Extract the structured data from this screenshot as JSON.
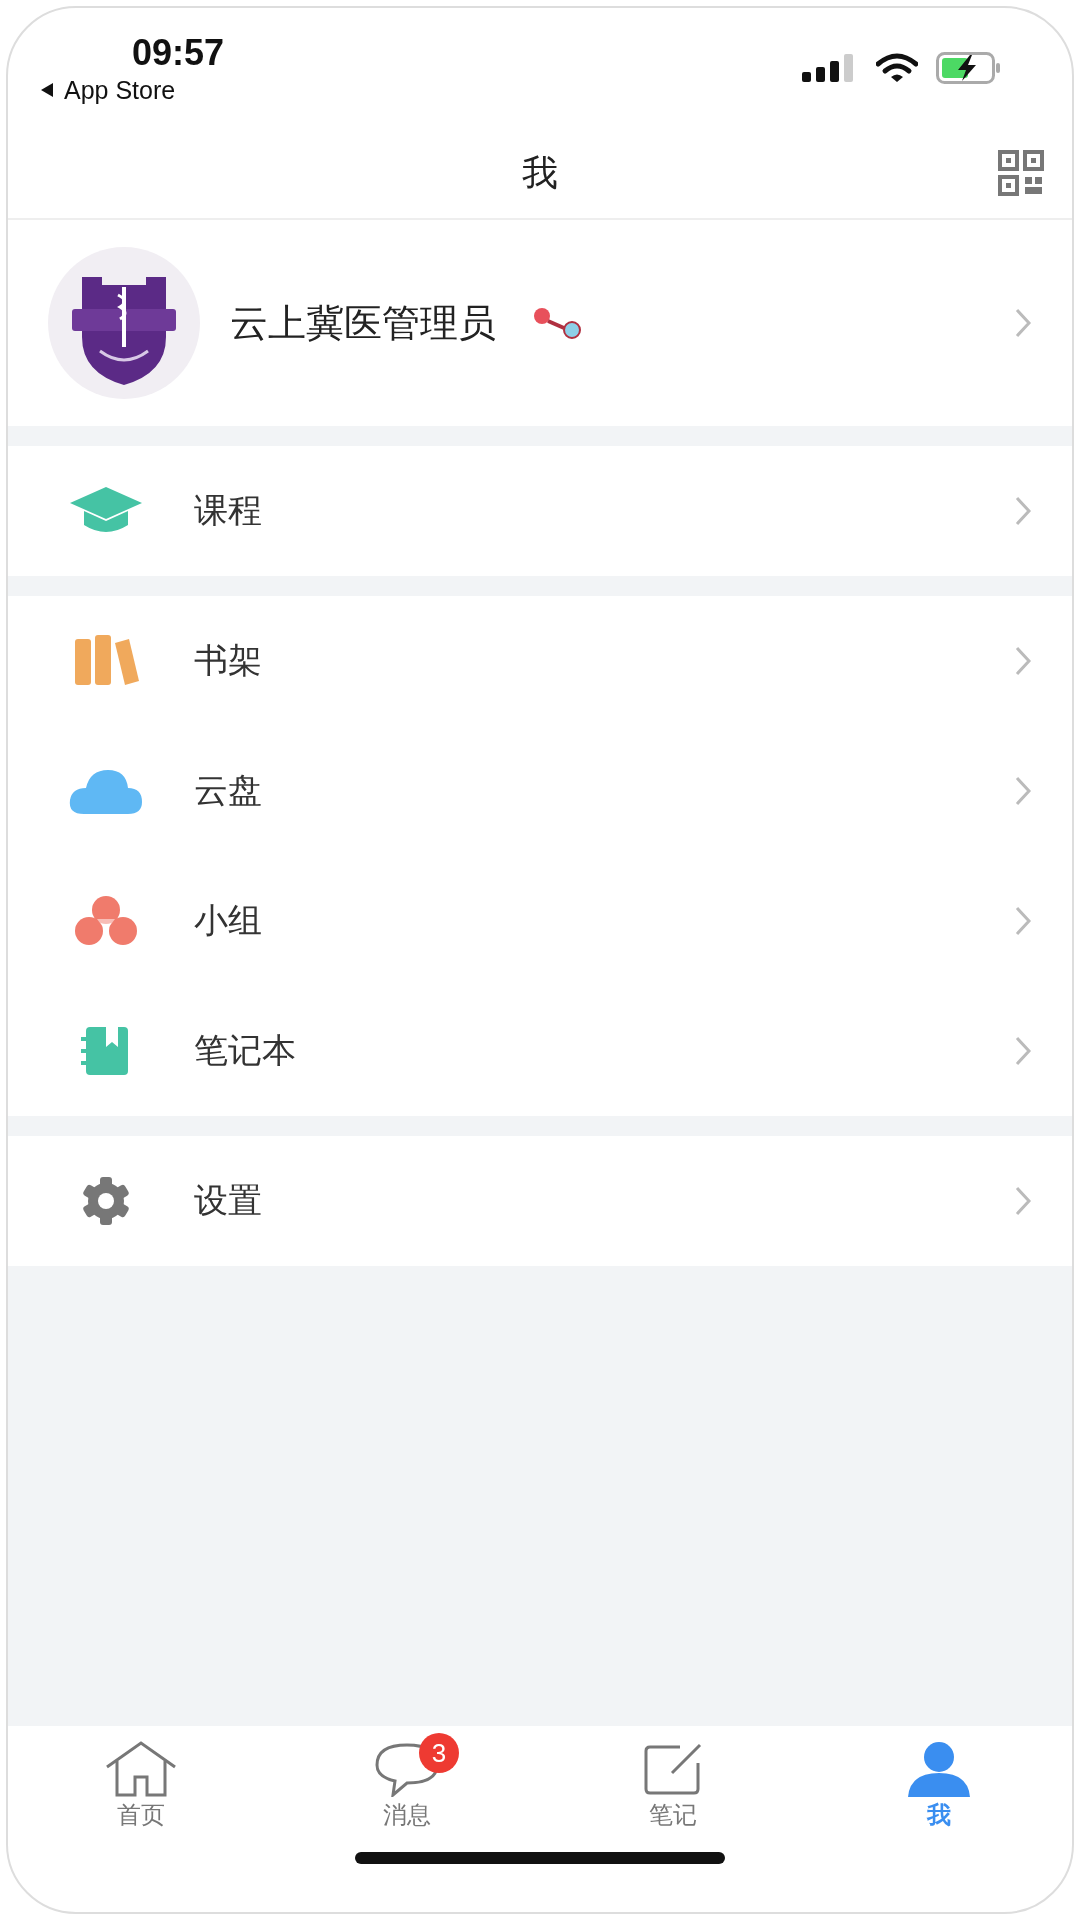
{
  "status_bar": {
    "time": "09:57",
    "back_label": "App Store"
  },
  "nav": {
    "title": "我"
  },
  "profile": {
    "name": "云上冀医管理员"
  },
  "menu_groups": [
    {
      "items": [
        {
          "kind": "course",
          "label": "课程"
        }
      ]
    },
    {
      "items": [
        {
          "kind": "bookshelf",
          "label": "书架"
        },
        {
          "kind": "cloud",
          "label": "云盘"
        },
        {
          "kind": "group",
          "label": "小组"
        },
        {
          "kind": "notebook",
          "label": "笔记本"
        }
      ]
    },
    {
      "items": [
        {
          "kind": "settings",
          "label": "设置"
        }
      ]
    }
  ],
  "tab_bar": [
    {
      "kind": "home",
      "label": "首页",
      "selected": false
    },
    {
      "kind": "messages",
      "label": "消息",
      "badge": "3",
      "selected": false
    },
    {
      "kind": "notes",
      "label": "笔记",
      "selected": false
    },
    {
      "kind": "me",
      "label": "我",
      "selected": true
    }
  ]
}
